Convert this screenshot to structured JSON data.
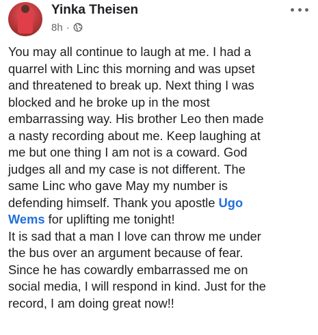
{
  "post": {
    "author": "Yinka Theisen",
    "time": "8h",
    "separator": "·",
    "privacy_icon": "globe-icon",
    "menu_icon": "more-options-icon",
    "lines": [
      "You may all continue to laugh at me. I had a",
      "quarrel with Linc this morning and was upset",
      "and threatened to break up. Next thing I was",
      "blocked and he broke up in the most",
      "embarrassing way. His brother Leo then made",
      "a nasty recording about me. Keep laughing at",
      "me but one thing I am not is a coward. God",
      "judges all and my case is not different. The",
      "same Linc who gave May my number is",
      "defending himself. Thank you apostle ",
      "for uplifting me tonight!",
      "It is sad that a man I love can throw me under",
      "the bus over an argument because of fear.",
      "Since he has cowardly embarrassed me on",
      "social media, I will respond in kind. Just for the",
      "record, I am doing great now!!"
    ],
    "mention_first": "Ugo",
    "mention_second": "Wems",
    "mention_color": "#216fdb",
    "text_color": "#1c1e21",
    "meta_color": "#65676b"
  }
}
